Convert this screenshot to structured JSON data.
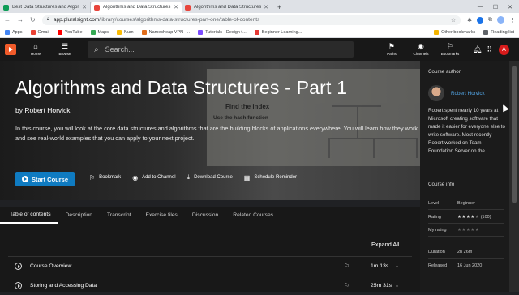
{
  "browser": {
    "tabs": [
      {
        "title": "Best Data Structures and Algori",
        "favicon_color": "#0f9d58",
        "active": false
      },
      {
        "title": "Algorithms and Data Structures",
        "favicon_color": "#e8453c",
        "active": true
      },
      {
        "title": "Algorithms and Data Structures",
        "favicon_color": "#e8453c",
        "active": false
      }
    ],
    "url_host": "app.pluralsight.com",
    "url_path": "/library/courses/algorithms-data-structures-part-one/table-of-contents",
    "bookmarks": [
      {
        "label": "Apps",
        "color": "#4285f4"
      },
      {
        "label": "Gmail",
        "color": "#ea4335"
      },
      {
        "label": "YouTube",
        "color": "#ff0000"
      },
      {
        "label": "Maps",
        "color": "#34a853"
      },
      {
        "label": "Num",
        "color": "#fbbc05"
      },
      {
        "label": "Namecheap VPN -...",
        "color": "#e06d1b"
      },
      {
        "label": "Tutorials - Design+...",
        "color": "#7c4dff"
      },
      {
        "label": "Beginner Learning...",
        "color": "#e53935"
      }
    ],
    "other_bookmarks": "Other bookmarks",
    "reading_list": "Reading list"
  },
  "psnav": {
    "home": "Home",
    "browse": "Browse",
    "search_placeholder": "Search...",
    "paths": "Paths",
    "channels": "Channels",
    "bookmarks": "Bookmarks",
    "avatar_initial": "A"
  },
  "hero": {
    "title": "Algorithms and Data Structures - Part 1",
    "author_line": "by Robert Horvick",
    "description": "In this course, you will look at the core data structures and algorithms that are the building blocks of applications everywhere. You will learn how they work and see real-world examples that you can apply to your next project.",
    "board_text_1": "Find the index",
    "board_text_2": "Use the hash function",
    "start_label": "Start Course",
    "actions": {
      "bookmark": "Bookmark",
      "add_channel": "Add to Channel",
      "download": "Download Course",
      "schedule": "Schedule Reminder"
    }
  },
  "sidebar": {
    "author_heading": "Course author",
    "author_name": "Robert Horvick",
    "author_bio": "Robert spent nearly 10 years at Microsoft creating software that made it easier for everyone else to write software. Most recently Robert worked on Team Foundation Server on the...",
    "info_heading": "Course info",
    "info": {
      "level_k": "Level",
      "level_v": "Beginner",
      "rating_k": "Rating",
      "rating_count": "(100)",
      "rating_value": 4,
      "myrating_k": "My rating",
      "duration_k": "Duration",
      "duration_v": "2h 26m",
      "released_k": "Released",
      "released_v": "16 Jun 2020"
    }
  },
  "course_tabs": [
    "Table of contents",
    "Description",
    "Transcript",
    "Exercise files",
    "Discussion",
    "Related Courses"
  ],
  "toc": {
    "expand_all": "Expand All",
    "modules": [
      {
        "title": "Course Overview",
        "duration": "1m 13s"
      },
      {
        "title": "Storing and Accessing Data",
        "duration": "25m 31s"
      }
    ]
  }
}
